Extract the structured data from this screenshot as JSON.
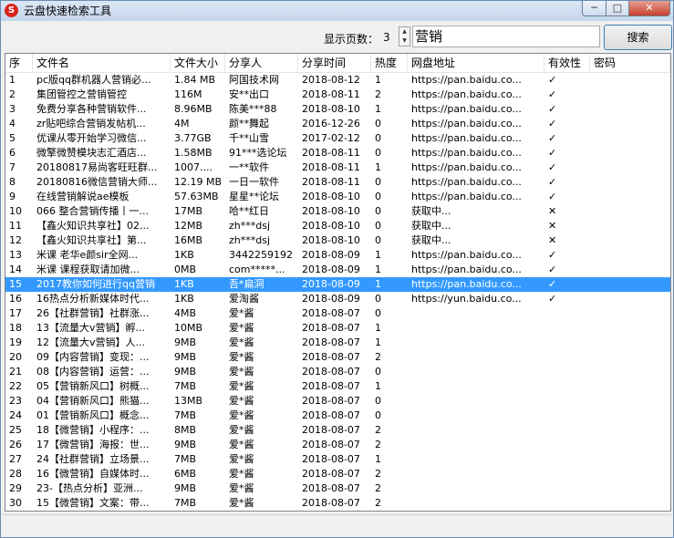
{
  "window": {
    "title": "云盘快速检索工具",
    "icon_letter": "S"
  },
  "controls": {
    "min": "─",
    "max": "□",
    "close": "✕"
  },
  "toolbar": {
    "pages_label": "显示页数：",
    "pages_value": "3",
    "spin_up": "▲",
    "spin_down": "▼",
    "search_value": "营销",
    "search_button": "搜索"
  },
  "columns": [
    "序",
    "文件名",
    "文件大小",
    "分享人",
    "分享时间",
    "热度",
    "网盘地址",
    "有效性",
    "密码"
  ],
  "selected_row": 14,
  "rows": [
    [
      "1",
      "pc版qq群机器人营销必...",
      "1.84 MB",
      "阿国技术网",
      "2018-08-12",
      "1",
      "https://pan.baidu.co...",
      "✓",
      ""
    ],
    [
      "2",
      "集团管控之营销管控",
      "116M",
      "安**出口",
      "2018-08-11",
      "2",
      "https://pan.baidu.co...",
      "✓",
      ""
    ],
    [
      "3",
      "免费分享各种营销软件...",
      "8.96MB",
      "陈美***88",
      "2018-08-10",
      "1",
      "https://pan.baidu.co...",
      "✓",
      ""
    ],
    [
      "4",
      "zr贴吧综合营销发帖机...",
      "4M",
      "颜**舞起",
      "2016-12-26",
      "0",
      "https://pan.baidu.co...",
      "✓",
      ""
    ],
    [
      "5",
      "优课从零开始学习微信...",
      "3.77GB",
      "千**山雪",
      "2017-02-12",
      "0",
      "https://pan.baidu.co...",
      "✓",
      ""
    ],
    [
      "6",
      "微擎微赞模块志汇酒店...",
      "1.58MB",
      "91***选论坛",
      "2018-08-11",
      "0",
      "https://pan.baidu.co...",
      "✓",
      ""
    ],
    [
      "7",
      "20180817易尚客旺旺群...",
      "1007....",
      "一**软件",
      "2018-08-11",
      "1",
      "https://pan.baidu.co...",
      "✓",
      ""
    ],
    [
      "8",
      "20180816微信营销大师...",
      "12.19 MB",
      "一日一软件",
      "2018-08-11",
      "0",
      "https://pan.baidu.co...",
      "✓",
      ""
    ],
    [
      "9",
      "在线营销解说ae模板",
      "57.63MB",
      "星星**论坛",
      "2018-08-10",
      "0",
      "https://pan.baidu.co...",
      "✓",
      ""
    ],
    [
      "10",
      "066 整合营销传播丨一...",
      "17MB",
      "哈**红日",
      "2018-08-10",
      "0",
      "获取中...",
      "✕",
      ""
    ],
    [
      "11",
      "【鑫火知识共享社】02...",
      "12MB",
      "zh***dsj",
      "2018-08-10",
      "0",
      "获取中...",
      "✕",
      ""
    ],
    [
      "12",
      "【鑫火知识共享社】第...",
      "16MB",
      "zh***dsj",
      "2018-08-10",
      "0",
      "获取中...",
      "✕",
      ""
    ],
    [
      "13",
      "米课 老华e颜sir全网...",
      "1KB",
      "3442259192",
      "2018-08-09",
      "1",
      "https://pan.baidu.co...",
      "✓",
      ""
    ],
    [
      "14",
      "米课 课程获取请加微...",
      "0MB",
      "com*****...",
      "2018-08-09",
      "1",
      "https://pan.baidu.co...",
      "✓",
      ""
    ],
    [
      "15",
      "2017教你如何进行qq营销",
      "1KB",
      "吾*扁洞",
      "2018-08-09",
      "1",
      "https://pan.baidu.co...",
      "✓",
      ""
    ],
    [
      "16",
      "16热点分析新媒体时代...",
      "1KB",
      "爱淘酱",
      "2018-08-09",
      "0",
      "https://yun.baidu.co...",
      "✓",
      ""
    ],
    [
      "17",
      "26【社群营销】社群涨...",
      "4MB",
      "爱*酱",
      "2018-08-07",
      "0",
      "",
      "",
      ""
    ],
    [
      "18",
      "13【流量大v营销】孵...",
      "10MB",
      "爱*酱",
      "2018-08-07",
      "1",
      "",
      "",
      ""
    ],
    [
      "19",
      "12【流量大v营销】人...",
      "9MB",
      "爱*酱",
      "2018-08-07",
      "1",
      "",
      "",
      ""
    ],
    [
      "20",
      "09【内容营销】变现：...",
      "9MB",
      "爱*酱",
      "2018-08-07",
      "2",
      "",
      "",
      ""
    ],
    [
      "21",
      "08【内容营销】运营：...",
      "9MB",
      "爱*酱",
      "2018-08-07",
      "0",
      "",
      "",
      ""
    ],
    [
      "22",
      "05【营销新风口】树概...",
      "7MB",
      "爱*酱",
      "2018-08-07",
      "1",
      "",
      "",
      ""
    ],
    [
      "23",
      "04【营销新风口】熊猫...",
      "13MB",
      "爱*酱",
      "2018-08-07",
      "0",
      "",
      "",
      ""
    ],
    [
      "24",
      "01【营销新风口】概念...",
      "7MB",
      "爱*酱",
      "2018-08-07",
      "0",
      "",
      "",
      ""
    ],
    [
      "25",
      "18【微营销】小程序：...",
      "8MB",
      "爱*酱",
      "2018-08-07",
      "2",
      "",
      "",
      ""
    ],
    [
      "26",
      "17【微营销】海报：世...",
      "9MB",
      "爱*酱",
      "2018-08-07",
      "2",
      "",
      "",
      ""
    ],
    [
      "27",
      "24【社群营销】立场景...",
      "7MB",
      "爱*酱",
      "2018-08-07",
      "1",
      "",
      "",
      ""
    ],
    [
      "28",
      "16【微营销】自媒体时...",
      "6MB",
      "爱*酱",
      "2018-08-07",
      "2",
      "",
      "",
      ""
    ],
    [
      "29",
      "23-【热点分析】亚洲...",
      "9MB",
      "爱*酱",
      "2018-08-07",
      "2",
      "",
      "",
      ""
    ],
    [
      "30",
      "15【微营销】文案：带...",
      "7MB",
      "爱*酱",
      "2018-08-07",
      "2",
      "",
      "",
      ""
    ]
  ]
}
